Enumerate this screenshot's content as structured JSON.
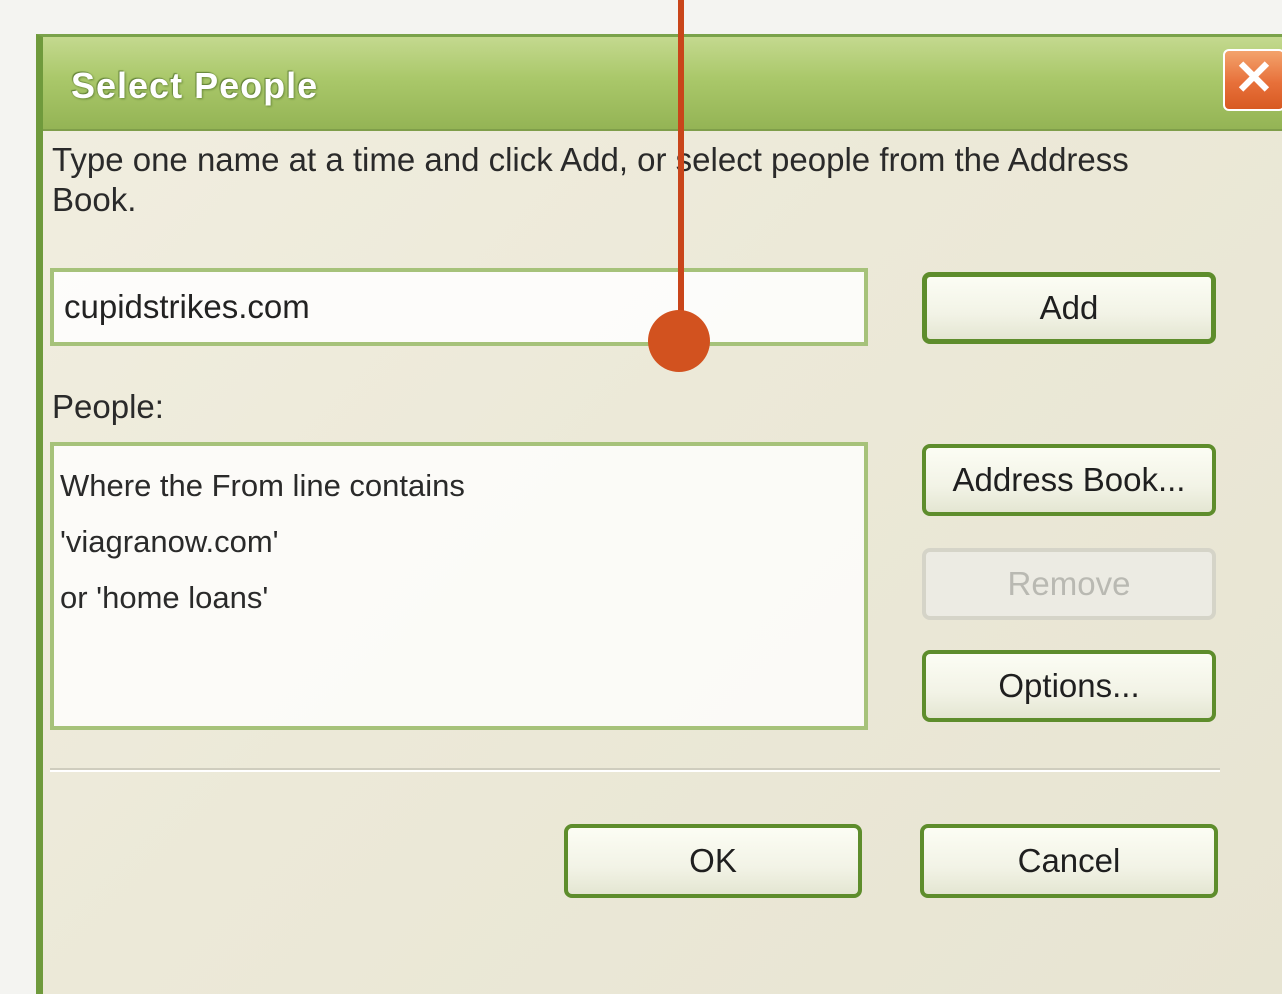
{
  "dialog": {
    "title": "Select People",
    "close_label": "✕",
    "instructions": "Type one name at a time and click Add, or select people from the Address Book."
  },
  "name_input": {
    "value": "cupidstrikes.com"
  },
  "people": {
    "label": "People:",
    "entries": [
      "Where the From line contains",
      "'viagranow.com'",
      "or 'home loans'"
    ]
  },
  "buttons": {
    "add": "Add",
    "address_book": "Address Book...",
    "remove": "Remove",
    "options": "Options...",
    "ok": "OK",
    "cancel": "Cancel"
  },
  "colors": {
    "title_bar": "#aac86a",
    "button_border": "#5e8d2c",
    "callout": "#d2521f"
  }
}
